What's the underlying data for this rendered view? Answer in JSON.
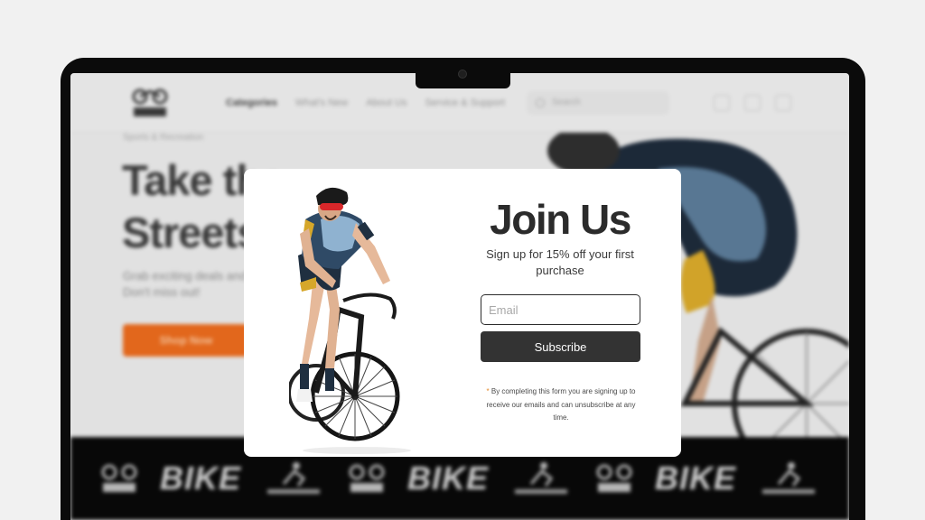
{
  "site": {
    "logo_text": "BIKES",
    "nav": [
      "Categories",
      "What's New",
      "About Us",
      "Service & Support"
    ],
    "search_placeholder": "Search",
    "hero": {
      "eyebrow": "Sports & Recreation",
      "title_line1": "Take the",
      "title_line2": "Streets",
      "subtitle": "Grab exciting deals and Don't miss out!",
      "cta": "Shop Now"
    },
    "brand_strip": [
      "BIKES",
      "BIKE",
      "CYCLE CLUB",
      "BIKES",
      "BIKE",
      "CYCLE CLUB",
      "BIKES",
      "BIKE",
      "CYCLE CLUB"
    ]
  },
  "modal": {
    "title": "Join Us",
    "subtitle": "Sign up for 15% off your first purchase",
    "email_placeholder": "Email",
    "email_value": "",
    "subscribe_label": "Subscribe",
    "disclaimer_asterisk": "*",
    "disclaimer": "By completing this form you are signing up to receive our emails and can unsubscribe at any time."
  },
  "colors": {
    "accent": "#e76a1d",
    "button": "#333333",
    "strip_bg": "#090909"
  }
}
